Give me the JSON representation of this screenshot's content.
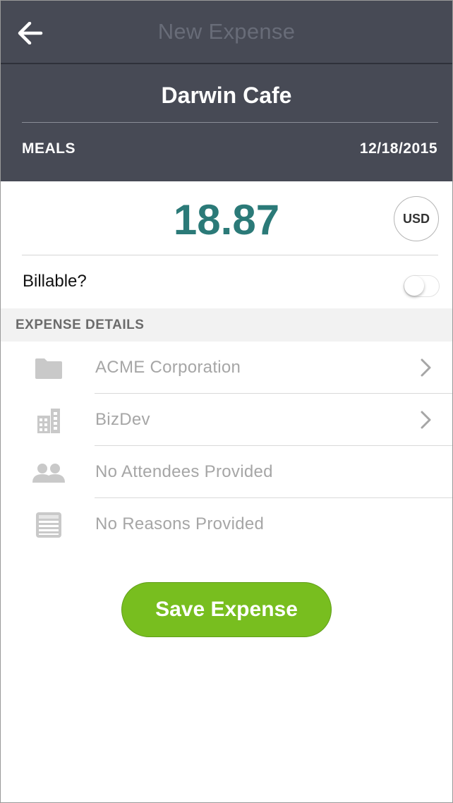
{
  "nav": {
    "title": "New Expense",
    "back_icon": "arrow-left-icon"
  },
  "expense": {
    "merchant": "Darwin Cafe",
    "category": "MEALS",
    "date": "12/18/2015",
    "amount": "18.87",
    "currency": "USD"
  },
  "billable": {
    "label": "Billable?",
    "enabled": false
  },
  "details": {
    "section_title": "EXPENSE DETAILS",
    "rows": [
      {
        "label": "ACME Corporation",
        "icon": "folder-icon",
        "has_chevron": true
      },
      {
        "label": "BizDev",
        "icon": "building-icon",
        "has_chevron": true
      },
      {
        "label": "No Attendees Provided",
        "icon": "people-icon",
        "has_chevron": false
      },
      {
        "label": "No Reasons Provided",
        "icon": "list-icon",
        "has_chevron": false
      }
    ]
  },
  "actions": {
    "save_label": "Save Expense"
  },
  "colors": {
    "header_bg": "#474a55",
    "amount": "#2b7a78",
    "save_button": "#78be1f",
    "muted_text": "#a6a6a6"
  }
}
